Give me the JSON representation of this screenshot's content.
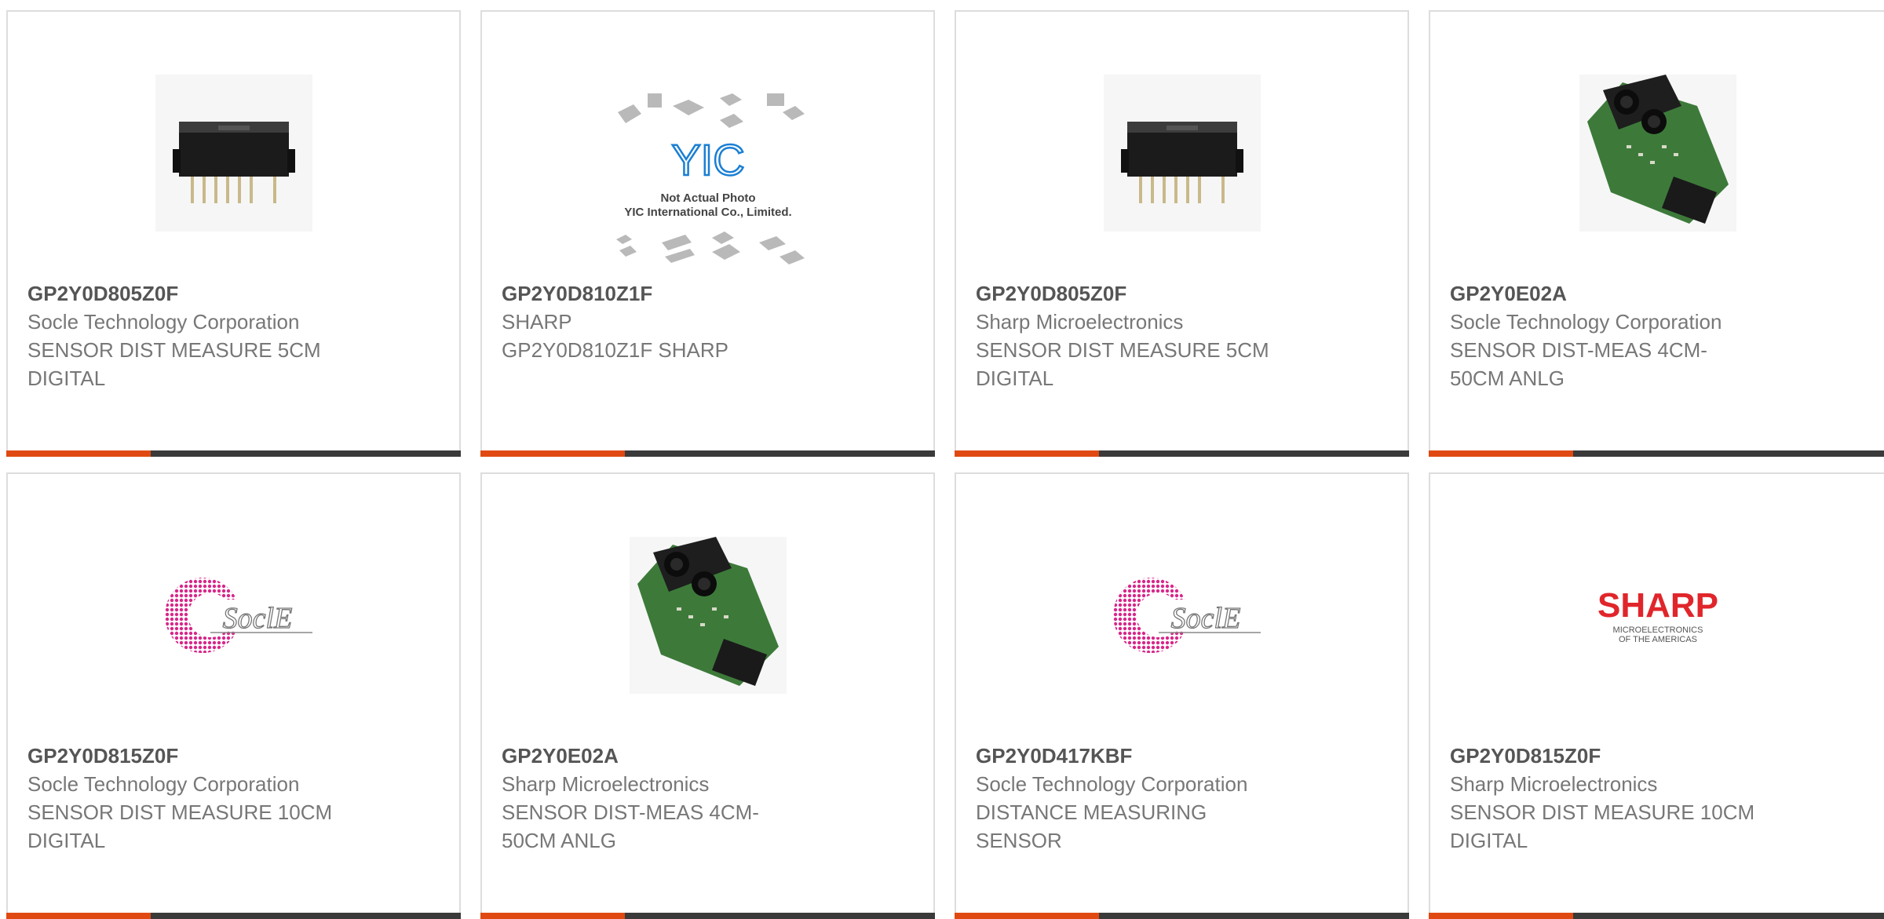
{
  "colors": {
    "accent": "#e04a12",
    "bar_dark": "#3a3a3a",
    "border": "#dddddd"
  },
  "products": [
    {
      "part": "GP2Y0D805Z0F",
      "maker": "Socle Technology Corporation",
      "desc1": "SENSOR DIST MEASURE 5CM",
      "desc2": "DIGITAL",
      "image": "chip-sensor-photo"
    },
    {
      "part": "GP2Y0D810Z1F",
      "maker": "SHARP",
      "desc1": "GP2Y0D810Z1F SHARP",
      "desc2": "",
      "image": "yic-placeholder",
      "placeholder_caption1": "Not Actual Photo",
      "placeholder_caption2": "YIC International Co., Limited.",
      "placeholder_logo": "YIC"
    },
    {
      "part": "GP2Y0D805Z0F",
      "maker": "Sharp Microelectronics",
      "desc1": "SENSOR DIST MEASURE 5CM",
      "desc2": "DIGITAL",
      "image": "chip-sensor-photo"
    },
    {
      "part": "GP2Y0E02A",
      "maker": "Socle Technology Corporation",
      "desc1": "SENSOR DIST-MEAS 4CM-",
      "desc2": "50CM ANLG",
      "image": "pcb-sensor-photo"
    },
    {
      "part": "GP2Y0D815Z0F",
      "maker": "Socle Technology Corporation",
      "desc1": "SENSOR DIST MEASURE 10CM",
      "desc2": "DIGITAL",
      "image": "socle-logo",
      "logo_text": "SoclE"
    },
    {
      "part": "GP2Y0E02A",
      "maker": "Sharp Microelectronics",
      "desc1": "SENSOR DIST-MEAS 4CM-",
      "desc2": "50CM ANLG",
      "image": "pcb-sensor-photo"
    },
    {
      "part": "GP2Y0D417KBF",
      "maker": "Socle Technology Corporation",
      "desc1": "DISTANCE MEASURING",
      "desc2": "SENSOR",
      "image": "socle-logo",
      "logo_text": "SoclE"
    },
    {
      "part": "GP2Y0D815Z0F",
      "maker": "Sharp Microelectronics",
      "desc1": "SENSOR DIST MEASURE 10CM",
      "desc2": "DIGITAL",
      "image": "sharp-logo",
      "logo_text": "SHARP",
      "logo_sub1": "MICROELECTRONICS",
      "logo_sub2": "OF THE AMERICAS"
    }
  ]
}
